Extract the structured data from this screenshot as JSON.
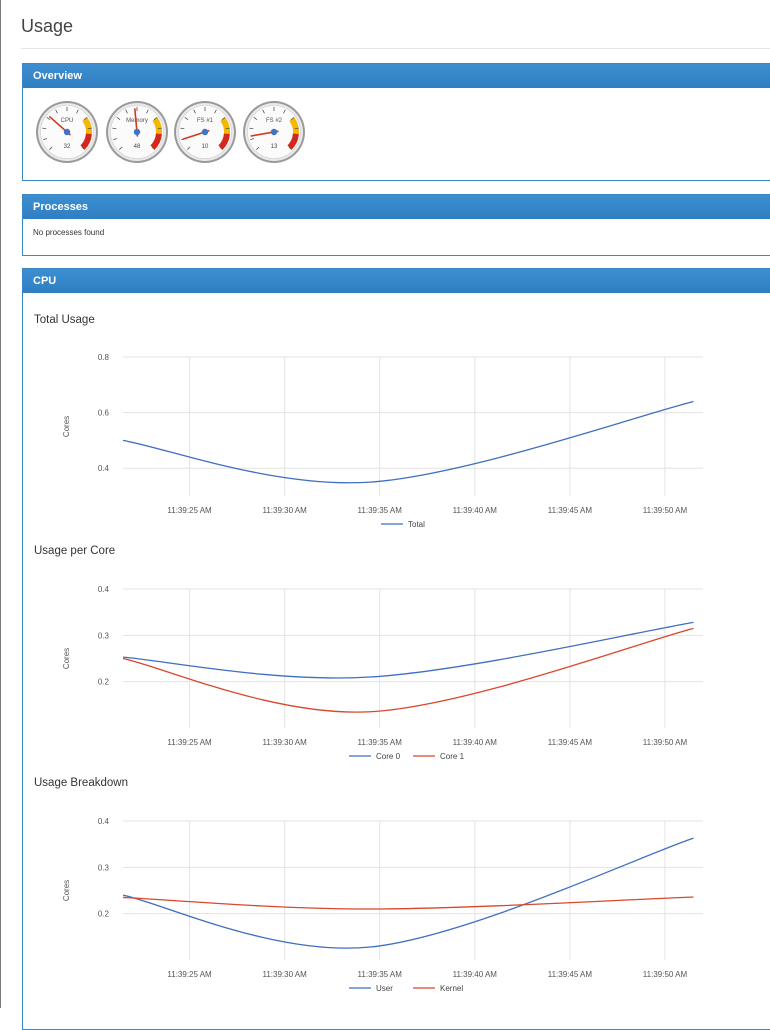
{
  "page": {
    "title": "Usage"
  },
  "overview": {
    "title": "Overview",
    "gauges": [
      {
        "label": "CPU",
        "value": 32
      },
      {
        "label": "Memory",
        "value": 48
      },
      {
        "label": "FS #1",
        "value": 10
      },
      {
        "label": "FS #2",
        "value": 13
      }
    ]
  },
  "processes": {
    "title": "Processes",
    "empty_text": "No processes found"
  },
  "cpu": {
    "title": "CPU",
    "charts": [
      {
        "title": "Total Usage",
        "ylabel": "Cores"
      },
      {
        "title": "Usage per Core",
        "ylabel": "Cores"
      },
      {
        "title": "Usage Breakdown",
        "ylabel": "Cores"
      }
    ]
  },
  "colors": {
    "blue": "#3f6fc0",
    "red": "#d9482b",
    "panel_header": "#3585c8"
  },
  "chart_data": [
    {
      "type": "line",
      "title": "Total Usage",
      "ylabel": "Cores",
      "ylim": [
        0.3,
        0.8
      ],
      "yticks": [
        0.4,
        0.6,
        0.8
      ],
      "yticklabels": [
        "0.4",
        "0.6",
        "0.8"
      ],
      "xlim": [
        21.5,
        52
      ],
      "xticks": [
        25,
        30,
        35,
        40,
        45,
        50
      ],
      "xticklabels": [
        "11:39:25 AM",
        "11:39:30 AM",
        "11:39:35 AM",
        "11:39:40 AM",
        "11:39:45 AM",
        "11:39:50 AM"
      ],
      "x": [
        21.5,
        34.5,
        51.5
      ],
      "series": [
        {
          "name": "Total",
          "color": "#3f6fc0",
          "values": [
            0.5,
            0.35,
            0.64
          ]
        }
      ]
    },
    {
      "type": "line",
      "title": "Usage per Core",
      "ylabel": "Cores",
      "ylim": [
        0.1,
        0.4
      ],
      "yticks": [
        0.2,
        0.3,
        0.4
      ],
      "yticklabels": [
        "0.2",
        "0.3",
        "0.4"
      ],
      "xlim": [
        21.5,
        52
      ],
      "xticks": [
        25,
        30,
        35,
        40,
        45,
        50
      ],
      "xticklabels": [
        "11:39:25 AM",
        "11:39:30 AM",
        "11:39:35 AM",
        "11:39:40 AM",
        "11:39:45 AM",
        "11:39:50 AM"
      ],
      "x": [
        21.5,
        34.5,
        51.5
      ],
      "series": [
        {
          "name": "Core 0",
          "color": "#3f6fc0",
          "values": [
            0.253,
            0.21,
            0.328
          ]
        },
        {
          "name": "Core 1",
          "color": "#d9482b",
          "values": [
            0.25,
            0.135,
            0.315
          ]
        }
      ]
    },
    {
      "type": "line",
      "title": "Usage Breakdown",
      "ylabel": "Cores",
      "ylim": [
        0.1,
        0.4
      ],
      "yticks": [
        0.2,
        0.3,
        0.4
      ],
      "yticklabels": [
        "0.2",
        "0.3",
        "0.4"
      ],
      "xlim": [
        21.5,
        52
      ],
      "xticks": [
        25,
        30,
        35,
        40,
        45,
        50
      ],
      "xticklabels": [
        "11:39:25 AM",
        "11:39:30 AM",
        "11:39:35 AM",
        "11:39:40 AM",
        "11:39:45 AM",
        "11:39:50 AM"
      ],
      "x": [
        21.5,
        34.5,
        51.5
      ],
      "series": [
        {
          "name": "User",
          "color": "#3f6fc0",
          "values": [
            0.24,
            0.128,
            0.363
          ]
        },
        {
          "name": "Kernel",
          "color": "#d9482b",
          "values": [
            0.235,
            0.21,
            0.236
          ]
        }
      ]
    }
  ]
}
